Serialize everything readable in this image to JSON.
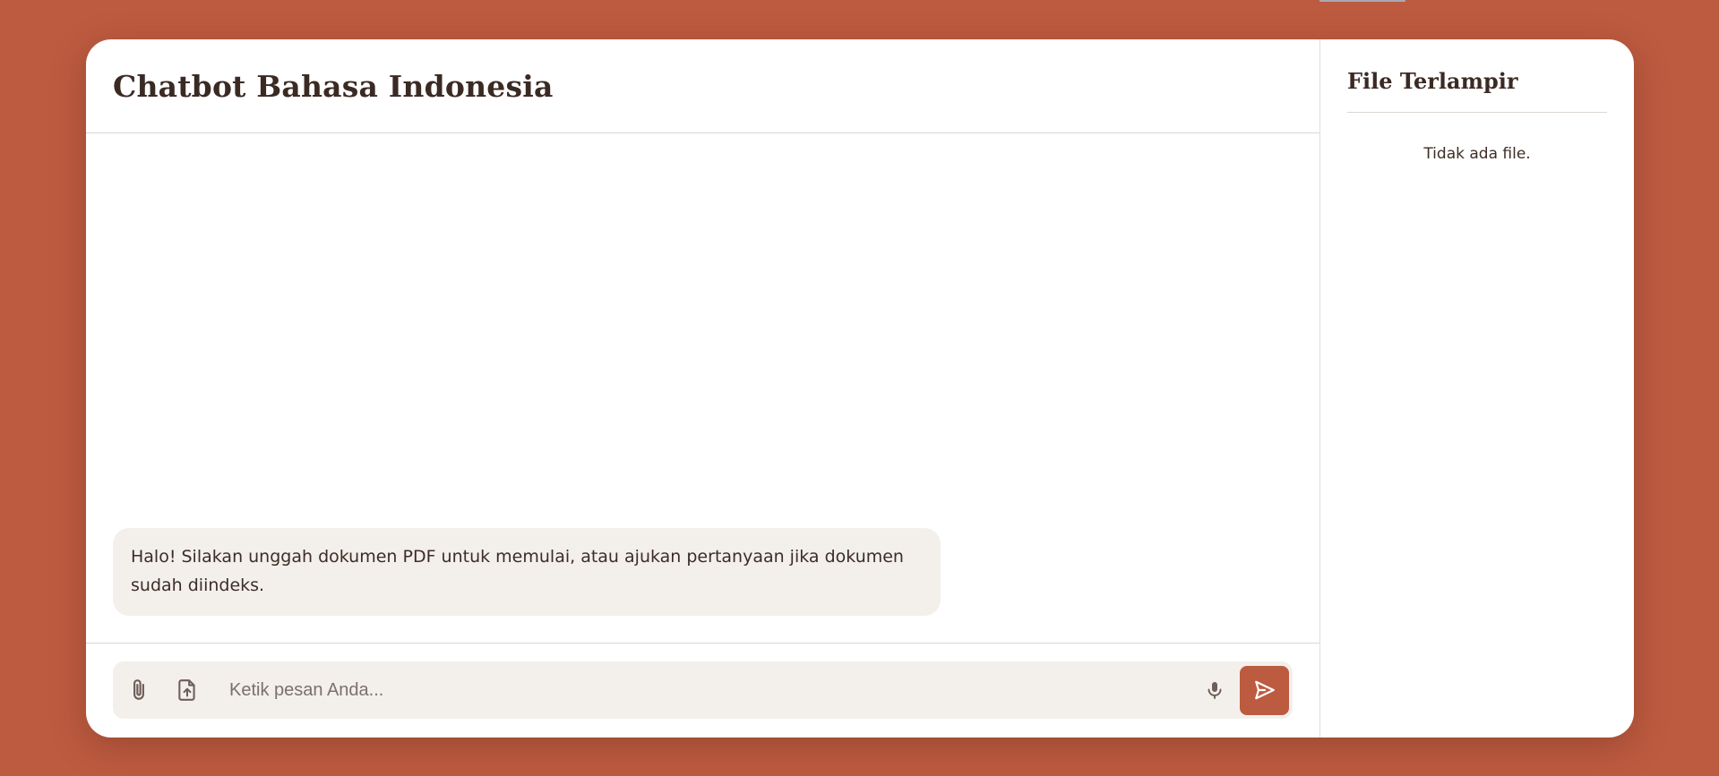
{
  "app": {
    "title": "Chatbot Bahasa Indonesia"
  },
  "messages": [
    {
      "role": "bot",
      "text": "Halo! Silakan unggah dokumen PDF untuk memulai, atau ajukan pertanyaan jika dokumen sudah diindeks."
    }
  ],
  "composer": {
    "placeholder": "Ketik pesan Anda...",
    "value": "",
    "attach_icon": "paperclip-icon",
    "upload_icon": "file-upload-icon",
    "mic_icon": "microphone-icon",
    "send_icon": "send-icon"
  },
  "files_panel": {
    "title": "File Terlampir",
    "empty_text": "Tidak ada file."
  },
  "colors": {
    "background": "#bd5b40",
    "accent": "#bd5b40",
    "bubble": "#f3f0ec",
    "text": "#3b2a24"
  }
}
